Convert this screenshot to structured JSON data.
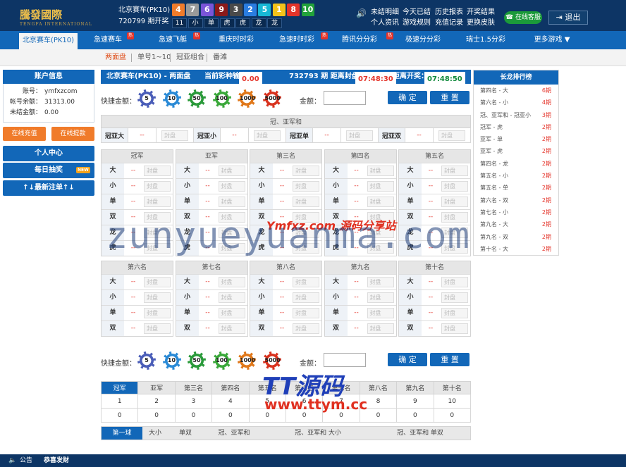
{
  "header": {
    "logo": "騰發國際",
    "logo_sub": "TENGFA INTERNATIONAL",
    "game_name": "北京赛车(PK10)",
    "period_line": "720799 期开奖",
    "balls": [
      {
        "n": "4",
        "c": "#f07b2a"
      },
      {
        "n": "7",
        "c": "#9a9a9a"
      },
      {
        "n": "6",
        "c": "#7a55d8"
      },
      {
        "n": "9",
        "c": "#8b1a1a"
      },
      {
        "n": "3",
        "c": "#4a4a4a"
      },
      {
        "n": "2",
        "c": "#2a7de1"
      },
      {
        "n": "5",
        "c": "#17b8d6"
      },
      {
        "n": "1",
        "c": "#f3c21a"
      },
      {
        "n": "8",
        "c": "#e4342a"
      },
      {
        "n": "10",
        "c": "#22a23a"
      }
    ],
    "tags": [
      "11",
      "小",
      "单",
      "虎",
      "虎",
      "龙",
      "龙"
    ],
    "links": [
      "未结明细",
      "今天已结",
      "历史报表",
      "开奖结果",
      "个人资讯",
      "游戏规则",
      "充值记录",
      "更换皮肤"
    ],
    "service": "在线客服",
    "logout": "退出"
  },
  "nav": {
    "tabs": [
      {
        "label": "北京赛车(PK10)",
        "hot": false
      },
      {
        "label": "急速赛车",
        "hot": true
      },
      {
        "label": "急速飞艇",
        "hot": true
      },
      {
        "label": "重庆时时彩",
        "hot": false
      },
      {
        "label": "急速时时彩",
        "hot": true
      },
      {
        "label": "腾讯分分彩",
        "hot": true
      },
      {
        "label": "极速分分彩",
        "hot": false
      },
      {
        "label": "瑞士1.5分彩",
        "hot": false
      },
      {
        "label": "更多游戏 ▼",
        "hot": false
      }
    ],
    "hot_label": "热"
  },
  "subnav": {
    "tabs": [
      "两面盘",
      "单号1~10",
      "冠亚组合",
      "番滩"
    ]
  },
  "account": {
    "title": "账户信息",
    "rows": [
      {
        "k": "账号：",
        "v": "ymfxzcom"
      },
      {
        "k": "帐号余额：",
        "v": "31313.00"
      },
      {
        "k": "未结金额：",
        "v": "0.00"
      }
    ],
    "deposit": "在线充值",
    "withdraw": "在线提款",
    "buttons": [
      "个人中心",
      "每日抽奖",
      "↑↓最新注单↑↓"
    ],
    "new_badge": "NEW"
  },
  "main": {
    "title": "北京赛车(PK10)  -  两面盘",
    "loss_label": "当前彩种输赢：",
    "loss_value": "0.00",
    "period": "732793 期 距离封盘：",
    "close_time": "07:48:30",
    "open_label": "距离开奖：",
    "open_time": "07:48:50",
    "quick_label": "快捷金额：",
    "chips": [
      "5",
      "10",
      "50",
      "100",
      "1000",
      "5000"
    ],
    "amount_label": "金额：",
    "confirm": "确 定",
    "reset": "重 置",
    "sum_title": "冠、亚军和",
    "sum_cells": [
      {
        "l": "冠亚大",
        "o": "--"
      },
      {
        "l": "冠亚小",
        "o": "--"
      },
      {
        "l": "冠亚单",
        "o": "--"
      },
      {
        "l": "冠亚双",
        "o": "--"
      }
    ],
    "lock_text": "封盘",
    "positions_top": [
      "冠军",
      "亚军",
      "第三名",
      "第四名",
      "第五名"
    ],
    "labels_top": [
      "大",
      "小",
      "单",
      "双",
      "龙",
      "虎"
    ],
    "positions_bottom": [
      "第六名",
      "第七名",
      "第八名",
      "第九名",
      "第十名"
    ],
    "labels_bottom": [
      "大",
      "小",
      "单",
      "双"
    ],
    "odds_placeholder": "--"
  },
  "results": {
    "tabs": [
      "冠军",
      "亚军",
      "第三名",
      "第四名",
      "第五名",
      "第六名",
      "第七名",
      "第八名",
      "第九名",
      "第十名"
    ],
    "row1": [
      "1",
      "2",
      "3",
      "4",
      "5",
      "6",
      "7",
      "8",
      "9",
      "10"
    ],
    "row2": [
      "0",
      "0",
      "0",
      "0",
      "0",
      "0",
      "0",
      "0",
      "0",
      "0"
    ],
    "bottom_tabs": [
      "第一球",
      "大小",
      "单双",
      "冠、亚军和",
      "冠、亚军和 大小",
      "冠、亚军和 单双"
    ]
  },
  "rank": {
    "title": "长龙排行榜",
    "rows": [
      {
        "n": "第四名 - 大",
        "c": "6期"
      },
      {
        "n": "第六名 - 小",
        "c": "4期"
      },
      {
        "n": "冠、亚军和 - 冠亚小",
        "c": "3期"
      },
      {
        "n": "冠军 - 虎",
        "c": "2期"
      },
      {
        "n": "亚军 - 单",
        "c": "2期"
      },
      {
        "n": "亚军 - 虎",
        "c": "2期"
      },
      {
        "n": "第四名 - 龙",
        "c": "2期"
      },
      {
        "n": "第五名 - 小",
        "c": "2期"
      },
      {
        "n": "第五名 - 单",
        "c": "2期"
      },
      {
        "n": "第六名 - 双",
        "c": "2期"
      },
      {
        "n": "第七名 - 小",
        "c": "2期"
      },
      {
        "n": "第九名 - 大",
        "c": "2期"
      },
      {
        "n": "第九名 - 双",
        "c": "2期"
      },
      {
        "n": "第十名 - 大",
        "c": "2期"
      }
    ]
  },
  "footer": {
    "notice_label": "公告",
    "notice": "恭喜发财"
  },
  "watermarks": {
    "ymfxz": "Ymfxz.com 源码分享站",
    "zun": "zunyueyuanma.com",
    "tt": "TT源码",
    "ttym": "www.ttym.cc"
  }
}
